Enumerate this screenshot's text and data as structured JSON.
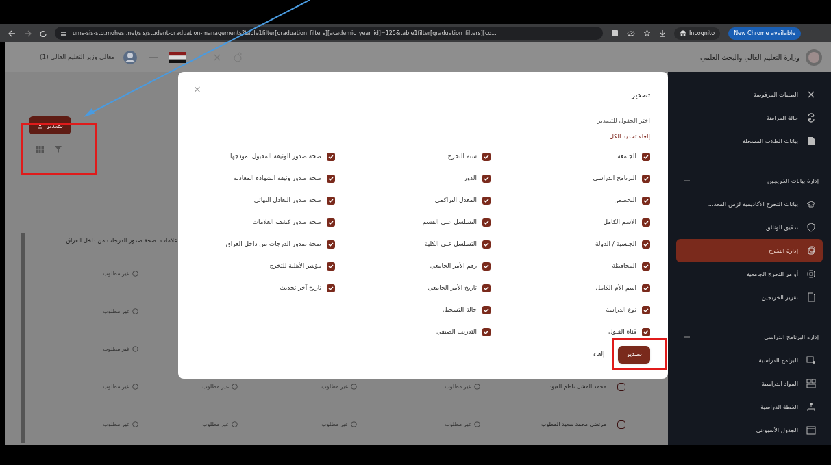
{
  "browser": {
    "url": "ums-sis-stg.mohesr.net/sis/student-graduation-managements?table1filter[graduation_filters][academic_year_id]=125&table1filter[graduation_filters][co...",
    "incognito": "Incognito",
    "update_button": "New Chrome available"
  },
  "header": {
    "user_name": "معالي وزير التعليم العالي (1)",
    "ministry": "وزارة التعليم العالي والبحث العلمي"
  },
  "sidebar": {
    "items": [
      {
        "kind": "link",
        "label": "الطلبات المرفوضة",
        "selected": false
      },
      {
        "kind": "link",
        "label": "حالة المزامنة",
        "selected": false
      },
      {
        "kind": "link",
        "label": "بيانات الطلاب المسجلة",
        "selected": false
      },
      {
        "kind": "section",
        "label": "إدارة بيانات الخريجين",
        "expanded": true
      },
      {
        "kind": "link",
        "label": "بيانات التخرج الأكاديمية لزمن المعد...",
        "selected": false
      },
      {
        "kind": "link",
        "label": "تدقيق الوثائق",
        "selected": false
      },
      {
        "kind": "link",
        "label": "إدارة التخرج",
        "selected": true
      },
      {
        "kind": "link",
        "label": "أوامر التخرج الجامعية",
        "selected": false
      },
      {
        "kind": "link",
        "label": "تقرير الخريجين",
        "selected": false
      },
      {
        "kind": "section",
        "label": "إدارة البرنامج الدراسي",
        "expanded": true
      },
      {
        "kind": "link",
        "label": "البرامج الدراسية",
        "selected": false
      },
      {
        "kind": "link",
        "label": "المواد الدراسية",
        "selected": false
      },
      {
        "kind": "link",
        "label": "الخطة الدراسية",
        "selected": false
      },
      {
        "kind": "link",
        "label": "الجدول الأسبوعي",
        "selected": false
      }
    ]
  },
  "main": {
    "export_button": "تصدير",
    "partial_header": "علامات",
    "result_column": {
      "header": "صحة صدور الدرجات من داخل العراق",
      "cells": [
        "غير مطلوب",
        "غير مطلوب",
        "غير مطلوب",
        "غير مطلوب",
        "غير مطلوب"
      ]
    },
    "rows_below_dialog": [
      {
        "checked": false,
        "name": "محمد المشل ناظم العبود",
        "cells": [
          "غير مطلوب",
          "غير مطلوب",
          "غير مطلوب"
        ]
      },
      {
        "checked": false,
        "name": "مرتضى محمد سعيد المطوب",
        "cells": [
          "غير مطلوب",
          "غير مطلوب",
          "غير مطلوب"
        ]
      }
    ]
  },
  "modal": {
    "title": "تصدير",
    "subtitle": "اختر الحقول للتصدير",
    "deselect_all": "إلغاء تحديد الكل",
    "close": "×",
    "columns": [
      [
        {
          "label": "الجامعة",
          "checked": true
        },
        {
          "label": "البرنامج الدراسي",
          "checked": true
        },
        {
          "label": "التخصص",
          "checked": true
        },
        {
          "label": "الاسم الكامل",
          "checked": true
        },
        {
          "label": "الجنسية / الدولة",
          "checked": true
        },
        {
          "label": "المحافظة",
          "checked": true
        },
        {
          "label": "اسم الأم الكامل",
          "checked": true
        },
        {
          "label": "نوع الدراسة",
          "checked": true
        },
        {
          "label": "قناة القبول",
          "checked": true
        }
      ],
      [
        {
          "label": "سنة التخرج",
          "checked": true
        },
        {
          "label": "الدور",
          "checked": true
        },
        {
          "label": "المعدل التراكمي",
          "checked": true
        },
        {
          "label": "التسلسل على القسم",
          "checked": true
        },
        {
          "label": "التسلسل على الكلية",
          "checked": true
        },
        {
          "label": "رقم الأمر الجامعي",
          "checked": true
        },
        {
          "label": "تاريخ الأمر الجامعي",
          "checked": true
        },
        {
          "label": "حالة التسجيل",
          "checked": true
        },
        {
          "label": "التدريب الصيفي",
          "checked": true
        }
      ],
      [
        {
          "label": "صحة صدور الوثيقة المقبول نموذجها",
          "checked": true
        },
        {
          "label": "صحة صدور وثيقة الشهادة المعادلة",
          "checked": true
        },
        {
          "label": "صحة صدور التعادل النهائي",
          "checked": true
        },
        {
          "label": "صحة صدور كشف العلامات",
          "checked": true
        },
        {
          "label": "صحة صدور الدرجات من داخل العراق",
          "checked": true
        },
        {
          "label": "مؤشر الأهلية للتخرج",
          "checked": true
        },
        {
          "label": "تاريخ آخر تحديث",
          "checked": true
        }
      ]
    ],
    "export_button": "تصدير",
    "cancel_button": "إلغاء"
  }
}
